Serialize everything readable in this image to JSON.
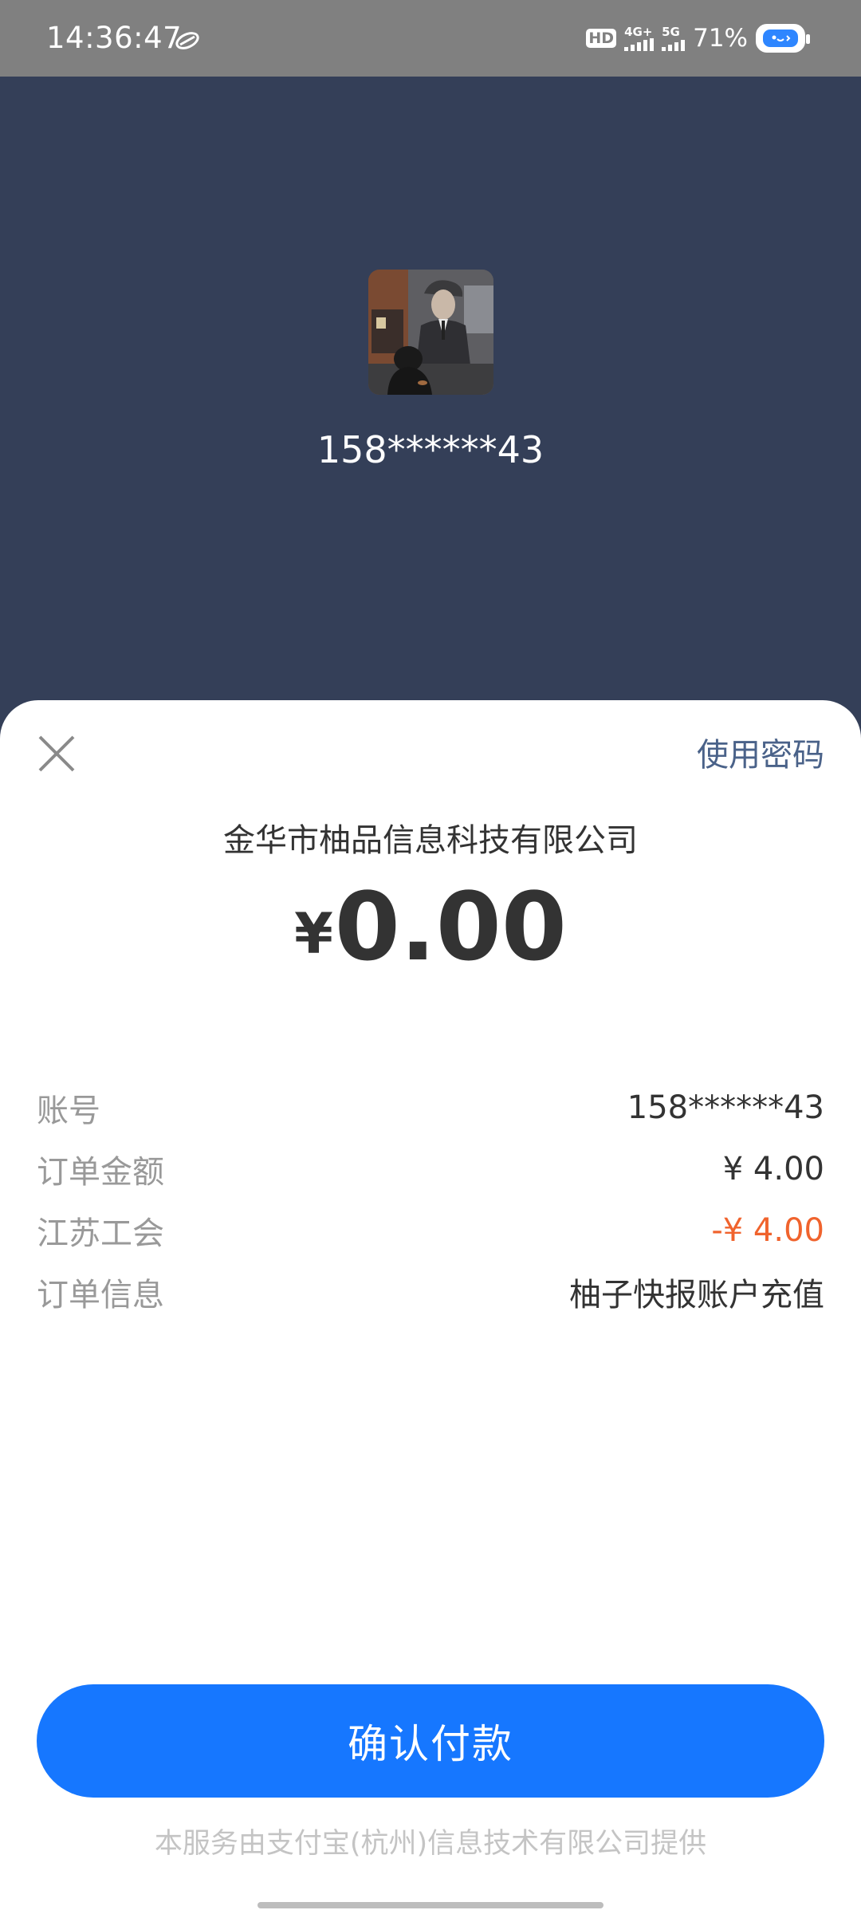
{
  "status_bar": {
    "time": "14:36:47",
    "hd_label": "HD",
    "network_1": "4G+",
    "network_2": "5G",
    "battery": "71%"
  },
  "profile": {
    "account": "158******43"
  },
  "sheet": {
    "use_password": "使用密码",
    "merchant": "金华市柚品信息科技有限公司",
    "currency_symbol": "¥",
    "amount": "0.00",
    "details": [
      {
        "label": "账号",
        "value": "158******43"
      },
      {
        "label": "订单金额",
        "value": "¥ 4.00"
      },
      {
        "label": "江苏工会",
        "value": "-¥ 4.00"
      },
      {
        "label": "订单信息",
        "value": "柚子快报账户充值"
      }
    ],
    "confirm_label": "确认付款",
    "footer": "本服务由支付宝(杭州)信息技术有限公司提供"
  },
  "colors": {
    "header_bg": "#343f58",
    "primary": "#1677ff",
    "discount": "#f0632d",
    "link": "#4a6289"
  }
}
